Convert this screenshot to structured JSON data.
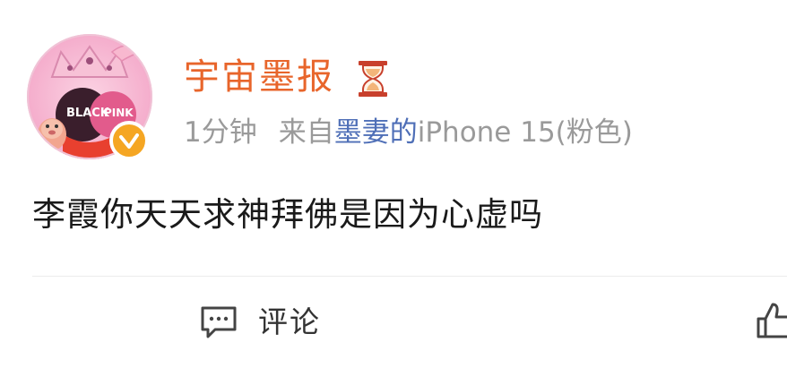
{
  "post": {
    "username": "宇宙墨报",
    "time": "1分钟",
    "source_prefix": "来自",
    "source_link": "墨妻的",
    "source_device": "iPhone 15(粉色)",
    "content": "李霞你天天求神拜佛是因为心虚吗"
  },
  "avatar": {
    "sticker_text_1": "BLACK",
    "sticker_text_2": "PINK"
  },
  "actions": {
    "comment_label": "评论"
  },
  "icons": {
    "verified": "verified-badge-icon",
    "hourglass": "hourglass-icon",
    "comment": "comment-icon",
    "like": "thumbs-up-icon"
  },
  "colors": {
    "username": "#e8652b",
    "link": "#4f6fb7",
    "meta": "#9a9a9a",
    "verified": "#f5a623"
  }
}
